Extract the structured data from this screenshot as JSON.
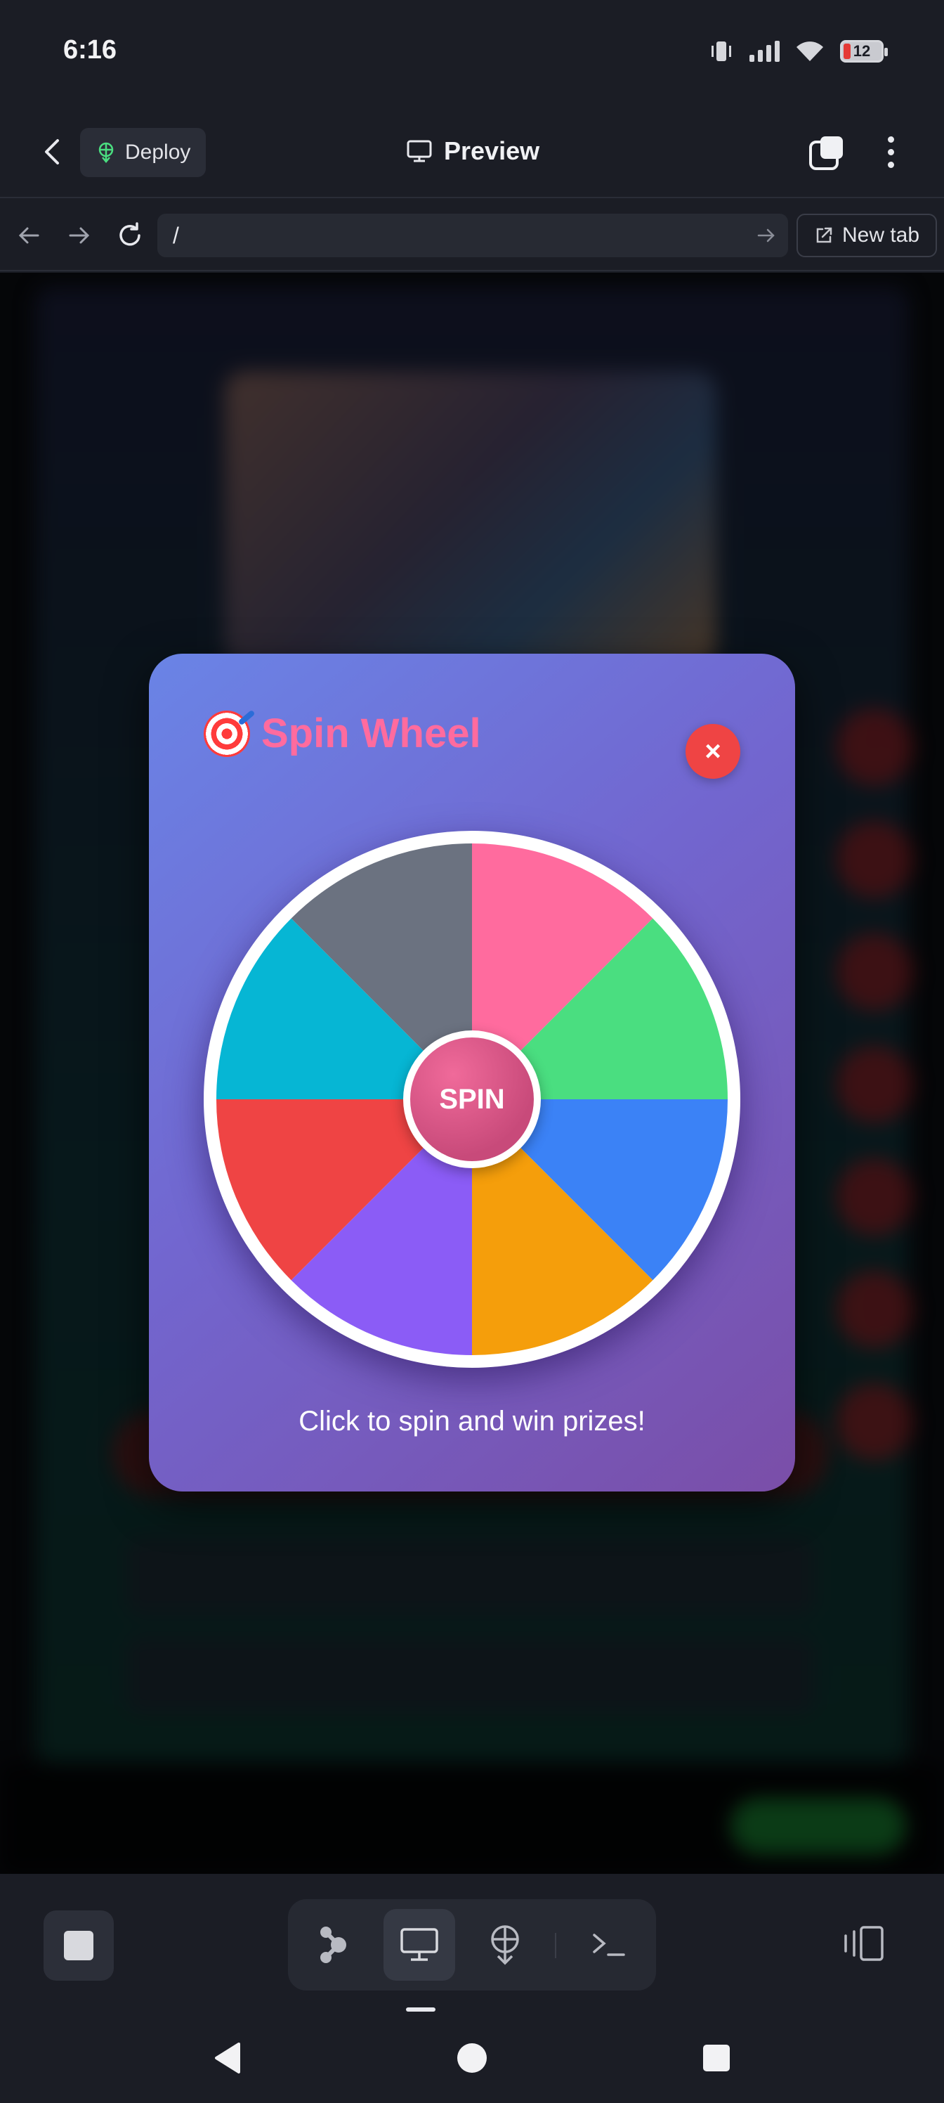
{
  "status_bar": {
    "time": "6:16",
    "battery_level": "12"
  },
  "header": {
    "back_icon": "chevron-left-icon",
    "deploy_label": "Deploy",
    "deploy_icon": "deploy-icon",
    "title": "Preview",
    "title_icon": "monitor-icon",
    "tabs_icon": "tabs-icon",
    "menu_icon": "kebab-menu-icon"
  },
  "browser": {
    "url": "/",
    "new_tab_label": "New tab",
    "new_tab_icon": "external-link-icon"
  },
  "modal": {
    "title": "Spin Wheel",
    "title_icon": "target-icon",
    "close_label": "×",
    "spin_label": "SPIN",
    "caption": "Click to spin and win prizes!",
    "segment_colors": [
      "#ff6b9e",
      "#4ade80",
      "#3b82f6",
      "#f59e0b",
      "#8b5cf6",
      "#ef4444",
      "#06b6d4",
      "#6b7280"
    ]
  },
  "toolbar": {
    "tools": [
      "agent-icon",
      "monitor-icon",
      "deploy-icon",
      "terminal-icon"
    ],
    "active_tool": "monitor-icon"
  },
  "colors": {
    "background": "#1b1d25",
    "accent_red": "#ef4444",
    "title_pink": "#ff6b9e"
  }
}
